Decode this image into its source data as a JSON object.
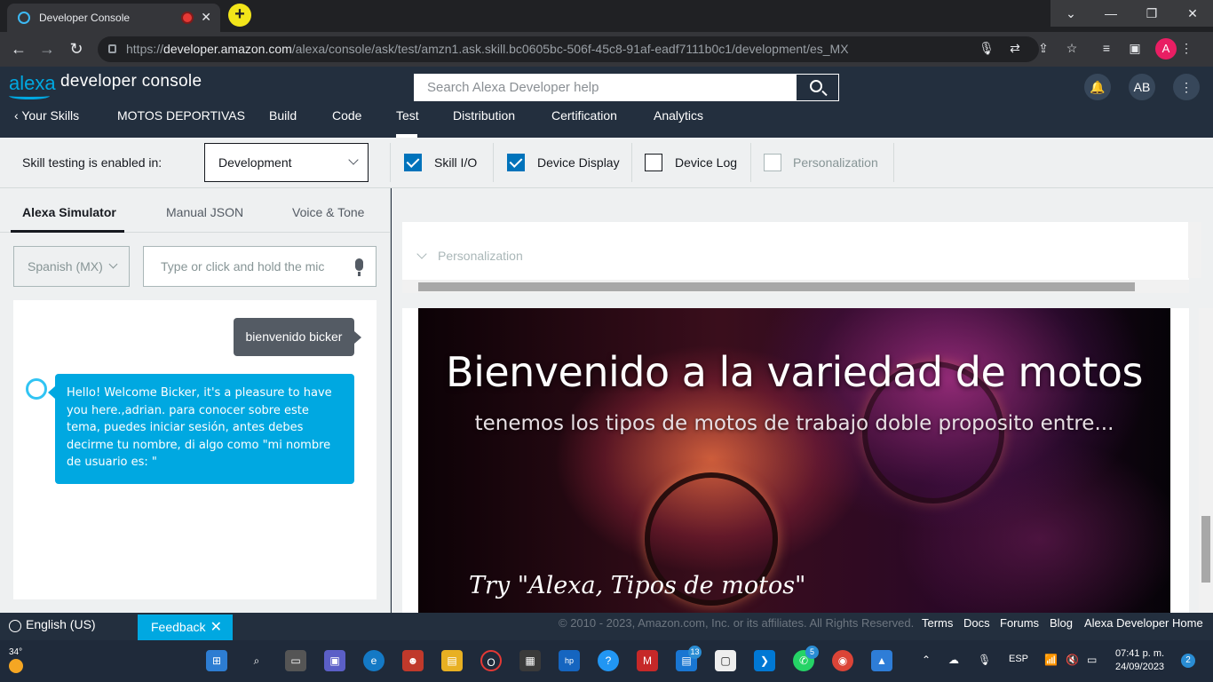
{
  "browser": {
    "tab_title": "Developer Console",
    "url_prefix": "https://",
    "url_host": "developer.amazon.com",
    "url_path": "/alexa/console/ask/test/amzn1.ask.skill.bc0605bc-506f-45c8-91af-eadf7111b0c1/development/es_MX",
    "profile_initial": "A"
  },
  "header": {
    "logo_text": "alexa",
    "logo_sub": "developer console",
    "search_placeholder": "Search Alexa Developer help",
    "user_initials": "AB",
    "nav": {
      "back": "Your Skills",
      "skill_name": "MOTOS DEPORTIVAS",
      "build": "Build",
      "code": "Code",
      "test": "Test",
      "distribution": "Distribution",
      "certification": "Certification",
      "analytics": "Analytics"
    }
  },
  "toolbar": {
    "label": "Skill testing is enabled in:",
    "stage": "Development",
    "skill_io": "Skill I/O",
    "device_display": "Device Display",
    "device_log": "Device Log",
    "personalization": "Personalization"
  },
  "simulator": {
    "tabs": [
      "Alexa Simulator",
      "Manual JSON",
      "Voice & Tone"
    ],
    "locale": "Spanish (MX)",
    "input_placeholder": "Type or click and hold the mic",
    "user_message": "bienvenido bicker",
    "alexa_message": "Hello! Welcome Bicker, it's a pleasure to have you here.,adrian. para conocer sobre este tema, puedes iniciar sesión, antes debes decirme tu nombre, di algo como \"mi nombre de usuario es: \""
  },
  "right_panel": {
    "personalization_label": "Personalization",
    "display_title": "Bienvenido a la variedad de motos",
    "display_subtitle": "tenemos los tipos de motos de trabajo doble proposito entre...",
    "display_hint": "Try \"Alexa, Tipos de motos\""
  },
  "footer": {
    "language": "English (US)",
    "feedback": "Feedback",
    "copyright": "© 2010 - 2023, Amazon.com, Inc. or its affiliates. All Rights Reserved.",
    "links": [
      "Terms",
      "Docs",
      "Forums",
      "Blog",
      "Alexa Developer Home"
    ]
  },
  "taskbar": {
    "temperature": "34°",
    "badge_teams": "13",
    "badge_whatsapp": "5",
    "input_lang": "ESP",
    "time": "07:41 p. m.",
    "date": "24/09/2023",
    "notifications": "2"
  },
  "colors": {
    "header_bg": "#232f3e",
    "accent": "#00a8e1",
    "checkbox": "#0073bb"
  }
}
